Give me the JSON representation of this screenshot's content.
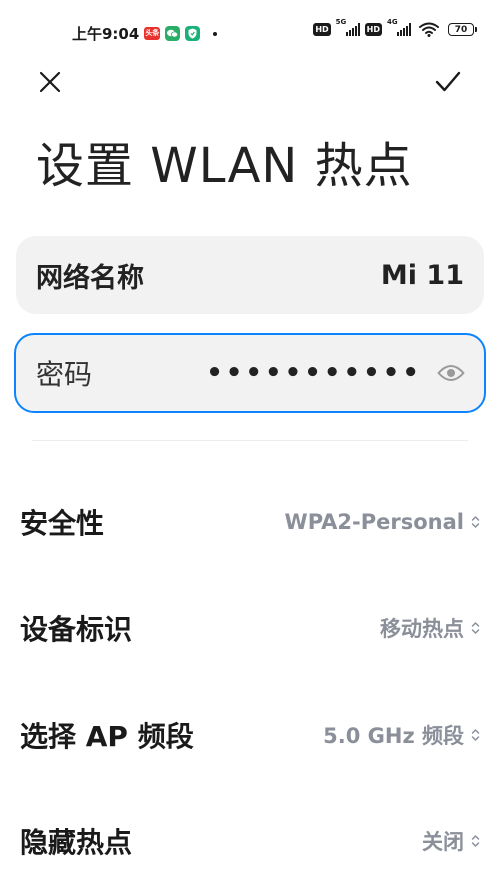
{
  "status_bar": {
    "time": "上午9:04",
    "toutiao_badge": "头条",
    "network_1": "5G",
    "network_2": "4G",
    "hd_1": "HD",
    "hd_2": "HD",
    "battery": "70",
    "icons": [
      "toutiao-icon",
      "wechat-icon",
      "shield-icon",
      "wifi-icon",
      "signal-icon",
      "battery-icon"
    ]
  },
  "header": {
    "close_icon": "close-icon",
    "confirm_icon": "check-icon",
    "title": "设置 WLAN 热点"
  },
  "network_name": {
    "label": "网络名称",
    "value": "Mi 11"
  },
  "password": {
    "label": "密码",
    "value": "•••••••••••",
    "toggle_icon": "eye-icon"
  },
  "settings": [
    {
      "label": "安全性",
      "value": "WPA2-Personal"
    },
    {
      "label": "设备标识",
      "value": "移动热点"
    },
    {
      "label": "选择 AP 频段",
      "value": "5.0 GHz 频段"
    },
    {
      "label": "隐藏热点",
      "value": "关闭"
    }
  ],
  "colors": {
    "accent": "#0d84ff",
    "card_bg": "#f2f2f2",
    "secondary_text": "#8a8f99"
  }
}
